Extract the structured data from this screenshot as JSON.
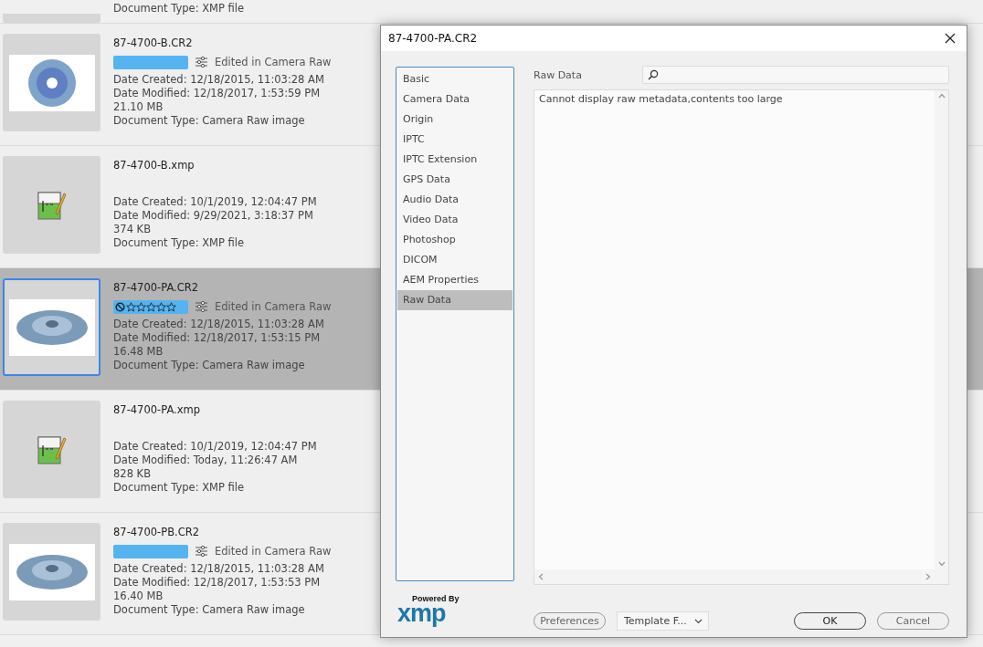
{
  "files": [
    {
      "kind": "partial",
      "lines": [
        "Document Type: XMP file"
      ]
    },
    {
      "kind": "image",
      "name": "87-4700-B.CR2",
      "selected": false,
      "color": "#55b4ef",
      "edited": "Edited in Camera Raw",
      "lines": [
        "Date Created: 12/18/2015, 11:03:28 AM",
        "Date Modified: 12/18/2017, 1:53:59 PM",
        "21.10 MB",
        "Document Type: Camera Raw image"
      ],
      "thumbnail": {
        "kind": "disc-front"
      }
    },
    {
      "kind": "sidecar",
      "name": "87-4700-B.xmp",
      "selected": false,
      "lines": [
        "Date Created: 10/1/2019, 12:04:47 PM",
        "Date Modified: 9/29/2021, 3:18:37 PM",
        "374 KB",
        "Document Type: XMP file"
      ],
      "thumbnail": {
        "kind": "document"
      }
    },
    {
      "kind": "image",
      "name": "87-4700-PA.CR2",
      "selected": true,
      "color": "#55b4ef",
      "stars": 0,
      "edited": "Edited in Camera Raw",
      "lines": [
        "Date Created: 12/18/2015, 11:03:28 AM",
        "Date Modified: 12/18/2017, 1:53:15 PM",
        "16.48 MB",
        "Document Type: Camera Raw image"
      ],
      "thumbnail": {
        "kind": "disc-angle"
      }
    },
    {
      "kind": "sidecar",
      "name": "87-4700-PA.xmp",
      "selected": false,
      "lines": [
        "Date Created: 10/1/2019, 12:04:47 PM",
        "Date Modified: Today, 11:26:47 AM",
        "828 KB",
        "Document Type: XMP file"
      ],
      "thumbnail": {
        "kind": "document"
      }
    },
    {
      "kind": "image",
      "name": "87-4700-PB.CR2",
      "selected": false,
      "color": "#55b4ef",
      "edited": "Edited in Camera Raw",
      "lines": [
        "Date Created: 12/18/2015, 11:03:28 AM",
        "Date Modified: 12/18/2017, 1:53:53 PM",
        "16.40 MB",
        "Document Type: Camera Raw image"
      ],
      "thumbnail": {
        "kind": "disc-angle"
      }
    }
  ],
  "dialog": {
    "title": "87-4700-PA.CR2",
    "categories": [
      {
        "label": "Basic",
        "selected": false
      },
      {
        "label": "Camera Data",
        "selected": false
      },
      {
        "label": "Origin",
        "selected": false
      },
      {
        "label": "IPTC",
        "selected": false
      },
      {
        "label": "IPTC Extension",
        "selected": false
      },
      {
        "label": "GPS Data",
        "selected": false
      },
      {
        "label": "Audio Data",
        "selected": false
      },
      {
        "label": "Video Data",
        "selected": false
      },
      {
        "label": "Photoshop",
        "selected": false
      },
      {
        "label": "DICOM",
        "selected": false
      },
      {
        "label": "AEM Properties",
        "selected": false
      },
      {
        "label": "Raw Data",
        "selected": true
      }
    ],
    "panel_label": "Raw Data",
    "content": "Cannot display raw metadata,contents too large",
    "logo": {
      "tagline": "Powered By",
      "mark": "xmp"
    },
    "buttons": {
      "preferences": "Preferences",
      "template": "Template F...",
      "ok": "OK",
      "cancel": "Cancel"
    }
  }
}
